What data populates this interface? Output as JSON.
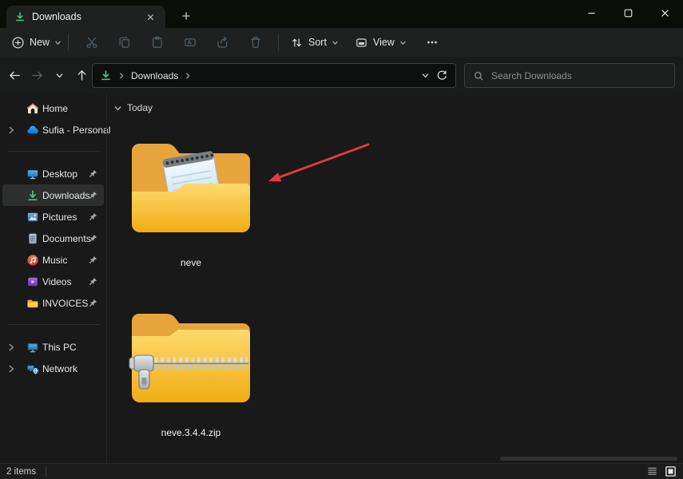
{
  "tab_bar": {
    "tab_label": "Downloads",
    "new_tab_symbol": "+"
  },
  "toolbar": {
    "new_label": "New",
    "sort_label": "Sort",
    "view_label": "View"
  },
  "address_bar": {
    "breadcrumb": "Downloads"
  },
  "search": {
    "placeholder": "Search Downloads"
  },
  "sidebar": {
    "items": [
      {
        "label": "Home",
        "icon": "home-icon"
      },
      {
        "label": "Sufia - Personal",
        "icon": "onedrive-cloud-icon"
      },
      {
        "label": "Desktop",
        "icon": "desktop-icon",
        "pinned": true
      },
      {
        "label": "Downloads",
        "icon": "downloads-icon",
        "pinned": true,
        "selected": true
      },
      {
        "label": "Pictures",
        "icon": "pictures-icon",
        "pinned": true
      },
      {
        "label": "Documents",
        "icon": "documents-icon",
        "pinned": true
      },
      {
        "label": "Music",
        "icon": "music-icon",
        "pinned": true
      },
      {
        "label": "Videos",
        "icon": "videos-icon",
        "pinned": true
      },
      {
        "label": "INVOICES",
        "icon": "folder-icon",
        "pinned": true
      },
      {
        "label": "This PC",
        "icon": "this-pc-icon"
      },
      {
        "label": "Network",
        "icon": "network-icon"
      }
    ]
  },
  "content": {
    "group_label": "Today",
    "items": [
      {
        "name": "neve",
        "type": "folder"
      },
      {
        "name": "neve.3.4.4.zip",
        "type": "zip-archive"
      }
    ]
  },
  "status_bar": {
    "items_count": "2 items"
  },
  "colors": {
    "accent_green": "#4cc38a",
    "folder_yellow": "#f5b915",
    "annotation_arrow_red": "#e23a40"
  }
}
